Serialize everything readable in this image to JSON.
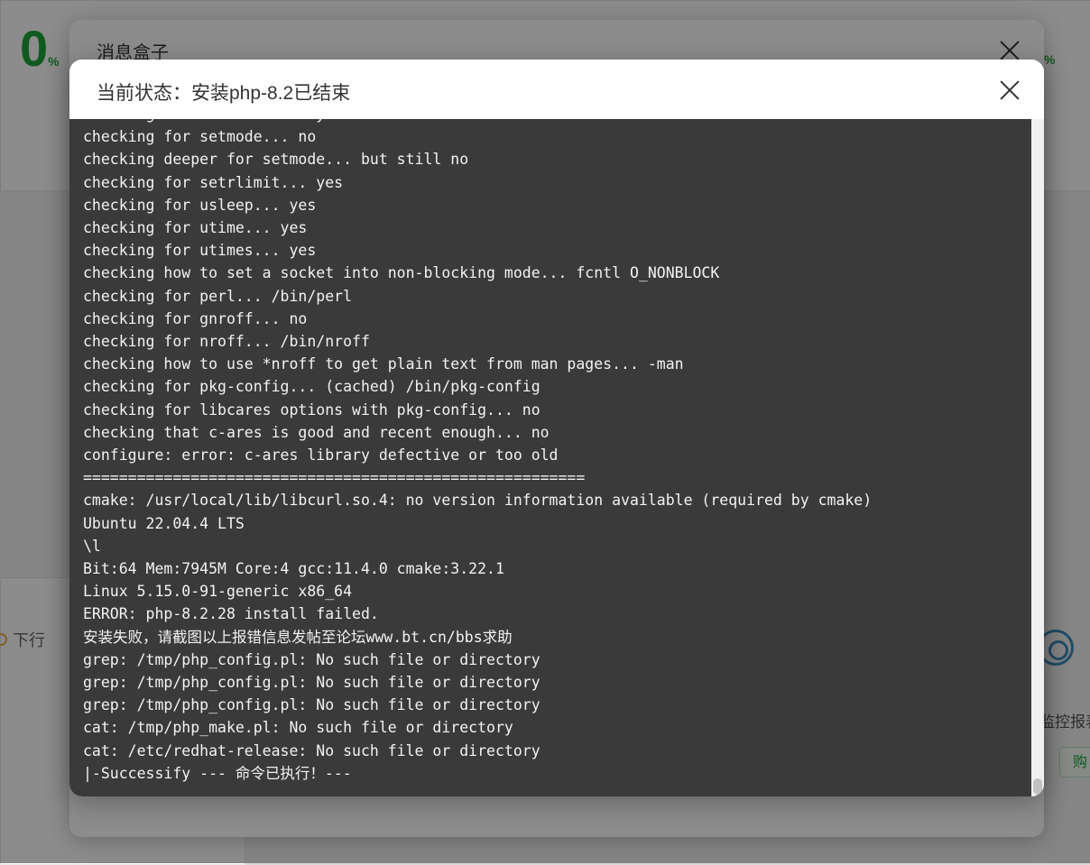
{
  "background": {
    "left_percent": "0",
    "percent_sign": "%",
    "right_percent": "%",
    "download_label": "下行",
    "side_text": "监控报表",
    "side_button": "购"
  },
  "message_box": {
    "title": "消息盒子"
  },
  "install_dialog": {
    "title": "当前状态：安装php-8.2已结束",
    "log_lines": [
      "checking for setrlimit... yes",
      "checking for setmode... no",
      "checking deeper for setmode... but still no",
      "checking for setrlimit... yes",
      "checking for usleep... yes",
      "checking for utime... yes",
      "checking for utimes... yes",
      "checking how to set a socket into non-blocking mode... fcntl O_NONBLOCK",
      "checking for perl... /bin/perl",
      "checking for gnroff... no",
      "checking for nroff... /bin/nroff",
      "checking how to use *nroff to get plain text from man pages... -man",
      "checking for pkg-config... (cached) /bin/pkg-config",
      "checking for libcares options with pkg-config... no",
      "checking that c-ares is good and recent enough... no",
      "configure: error: c-ares library defective or too old",
      "========================================================",
      "cmake: /usr/local/lib/libcurl.so.4: no version information available (required by cmake)",
      "Ubuntu 22.04.4 LTS",
      "\\l",
      "Bit:64 Mem:7945M Core:4 gcc:11.4.0 cmake:3.22.1",
      "Linux 5.15.0-91-generic x86_64",
      "ERROR: php-8.2.28 install failed.",
      "安装失败，请截图以上报错信息发帖至论坛www.bt.cn/bbs求助",
      "grep: /tmp/php_config.pl: No such file or directory",
      "grep: /tmp/php_config.pl: No such file or directory",
      "grep: /tmp/php_config.pl: No such file or directory",
      "cat: /tmp/php_make.pl: No such file or directory",
      "cat: /etc/redhat-release: No such file or directory",
      "|-Successify --- 命令已执行！---"
    ]
  }
}
